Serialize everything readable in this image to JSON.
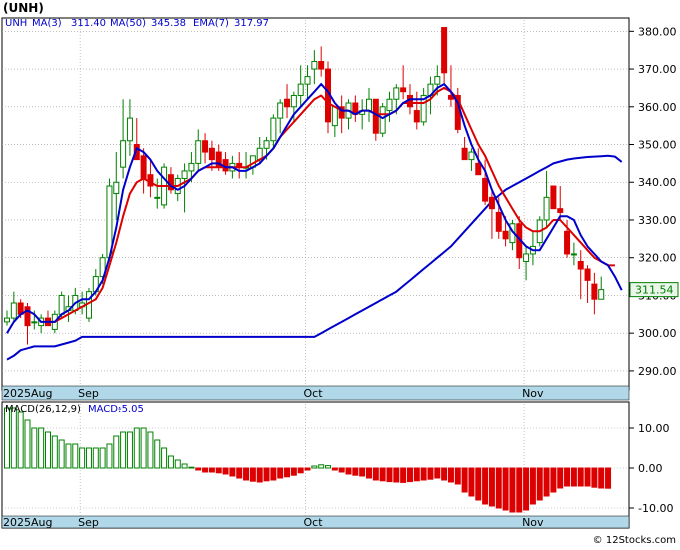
{
  "title": "(UNH)",
  "indicators": {
    "symbol": "UNH",
    "ma3": {
      "label": "MA(3)",
      "value": "311.40",
      "color": "#0000cc"
    },
    "ma50": {
      "label": "MA(50)",
      "value": "345.38",
      "color": "#0000cc"
    },
    "ema7": {
      "label": "EMA(7)",
      "value": "317.97",
      "color": "#dd0000"
    }
  },
  "last_price": "311.54",
  "macd": {
    "label": "MACD(26,12,9)",
    "value_label": "MACD:",
    "value": "-5.05"
  },
  "x_axis_labels": {
    "year_month": "2025Aug",
    "months": [
      "Sep",
      "Oct",
      "Nov"
    ]
  },
  "watermark": "© 12Stocks.com",
  "colors": {
    "up": "#008000",
    "down": "#dd0000",
    "ma": "#0000cc",
    "ema": "#dd0000",
    "axis_band": "#b0d8e8",
    "grid": "#999999"
  },
  "chart_data": [
    {
      "type": "candlestick",
      "ylim": [
        286,
        383
      ],
      "yticks": [
        "290.00",
        "300.00",
        "310.00",
        "320.00",
        "330.00",
        "340.00",
        "350.00",
        "360.00",
        "370.00",
        "380.00"
      ],
      "month_starts": [
        {
          "label": "Sep",
          "index": 11
        },
        {
          "label": "Oct",
          "index": 44
        },
        {
          "label": "Nov",
          "index": 76
        }
      ],
      "ohlc": [
        [
          303,
          306,
          302,
          304
        ],
        [
          304,
          311,
          303,
          308
        ],
        [
          308,
          309,
          304,
          305
        ],
        [
          307,
          308,
          297,
          302
        ],
        [
          303,
          306,
          301,
          303
        ],
        [
          302,
          305,
          300,
          304
        ],
        [
          304,
          306,
          302,
          302
        ],
        [
          301,
          306,
          300,
          305
        ],
        [
          305,
          311,
          304,
          310
        ],
        [
          306,
          310,
          303,
          307
        ],
        [
          306,
          312,
          305,
          310
        ],
        [
          307,
          311,
          305,
          308
        ],
        [
          304,
          312,
          303,
          311
        ],
        [
          311,
          317,
          310,
          315
        ],
        [
          315,
          321,
          313,
          320
        ],
        [
          320,
          341,
          319,
          339
        ],
        [
          337,
          348,
          330,
          340
        ],
        [
          344,
          362,
          341,
          351
        ],
        [
          351,
          362,
          347,
          357
        ],
        [
          350,
          357,
          346,
          346
        ],
        [
          347,
          349,
          337,
          341
        ],
        [
          342,
          346,
          336,
          339
        ],
        [
          336,
          341,
          333,
          336
        ],
        [
          334,
          345,
          333,
          344
        ],
        [
          342,
          344,
          337,
          338
        ],
        [
          337,
          342,
          335,
          341
        ],
        [
          341,
          345,
          332,
          343
        ],
        [
          343,
          348,
          340,
          345
        ],
        [
          345,
          354,
          343,
          351
        ],
        [
          351,
          353,
          345,
          348
        ],
        [
          349,
          351,
          343,
          346
        ],
        [
          348,
          350,
          343,
          344
        ],
        [
          346,
          348,
          342,
          343
        ],
        [
          343,
          347,
          341,
          345
        ],
        [
          345,
          348,
          341,
          344
        ],
        [
          344,
          348,
          341,
          344
        ],
        [
          344,
          347,
          342,
          347
        ],
        [
          346,
          352,
          345,
          349
        ],
        [
          349,
          352,
          346,
          351
        ],
        [
          351,
          358,
          349,
          357
        ],
        [
          357,
          362,
          353,
          361
        ],
        [
          362,
          366,
          357,
          360
        ],
        [
          360,
          364,
          356,
          363
        ],
        [
          363,
          371,
          360,
          366
        ],
        [
          366,
          371,
          362,
          368
        ],
        [
          370,
          375,
          366,
          372
        ],
        [
          372,
          376,
          368,
          370
        ],
        [
          370,
          372,
          353,
          356
        ],
        [
          355,
          360,
          352,
          360
        ],
        [
          360,
          363,
          353,
          357
        ],
        [
          357,
          362,
          354,
          361
        ],
        [
          361,
          363,
          356,
          358
        ],
        [
          358,
          362,
          354,
          359
        ],
        [
          359,
          365,
          356,
          362
        ],
        [
          362,
          362,
          351,
          353
        ],
        [
          353,
          361,
          352,
          360
        ],
        [
          359,
          364,
          356,
          362
        ],
        [
          362,
          366,
          358,
          365
        ],
        [
          365,
          371,
          362,
          364
        ],
        [
          363,
          366,
          358,
          360
        ],
        [
          359,
          364,
          354,
          356
        ],
        [
          356,
          365,
          355,
          363
        ],
        [
          363,
          368,
          358,
          366
        ],
        [
          366,
          371,
          363,
          368
        ],
        [
          381,
          381,
          366,
          369
        ],
        [
          363,
          371,
          360,
          362
        ],
        [
          363,
          365,
          353,
          354
        ],
        [
          349,
          352,
          346,
          346
        ],
        [
          346,
          349,
          343,
          348
        ],
        [
          345,
          349,
          342,
          342
        ],
        [
          341,
          346,
          334,
          335
        ],
        [
          336,
          338,
          325,
          333
        ],
        [
          332,
          336,
          325,
          327
        ],
        [
          327,
          331,
          323,
          325
        ],
        [
          324,
          330,
          322,
          329
        ],
        [
          329,
          331,
          317,
          320
        ],
        [
          319,
          323,
          314,
          321
        ],
        [
          321,
          327,
          318,
          323
        ],
        [
          324,
          331,
          323,
          330
        ],
        [
          330,
          343,
          328,
          336
        ],
        [
          339,
          339,
          333,
          333
        ],
        [
          333,
          339,
          330,
          332
        ],
        [
          327,
          330,
          320,
          321
        ],
        [
          321,
          324,
          318,
          321
        ],
        [
          319,
          322,
          309,
          317
        ],
        [
          317,
          318,
          308,
          314
        ],
        [
          313,
          316,
          305,
          309
        ],
        [
          309,
          315,
          309,
          311.54
        ]
      ],
      "ma3": [
        300,
        303,
        305,
        306,
        305,
        303,
        303,
        303,
        305,
        306,
        308,
        309,
        309,
        311,
        314,
        320,
        328,
        338,
        344,
        349,
        348,
        346,
        343,
        341,
        339,
        338,
        339,
        341,
        343,
        344,
        345,
        345,
        344,
        344,
        343,
        343,
        344,
        345,
        347,
        349,
        352,
        355,
        358,
        360,
        362,
        364,
        366,
        364,
        361,
        359,
        359,
        358,
        359,
        359,
        358,
        357,
        358,
        359,
        361,
        362,
        362,
        362,
        363,
        365,
        366,
        364,
        361,
        355,
        350,
        346,
        343,
        338,
        334,
        330,
        327,
        325,
        323,
        322,
        322,
        325,
        328,
        331,
        331,
        330,
        326,
        323,
        321,
        319,
        318,
        315,
        311.4
      ],
      "ema7": [
        null,
        null,
        null,
        null,
        null,
        null,
        303,
        303,
        304,
        305,
        306,
        307,
        308,
        309,
        312,
        318,
        324,
        331,
        337,
        340,
        341,
        340,
        339,
        339,
        339,
        339,
        340,
        341,
        343,
        344,
        344,
        344,
        344,
        344,
        344,
        344,
        345,
        346,
        347,
        349,
        352,
        354,
        356,
        358,
        360,
        362,
        363,
        361,
        360,
        359,
        359,
        358,
        359,
        359,
        358,
        358,
        358,
        359,
        361,
        361,
        361,
        361,
        362,
        364,
        365,
        364,
        362,
        358,
        354,
        350,
        347,
        343,
        339,
        336,
        333,
        330,
        328,
        327,
        327,
        328,
        330,
        330,
        328,
        326,
        324,
        322,
        320,
        319,
        318,
        317.97
      ],
      "ma50": [
        293,
        294,
        295.5,
        296,
        296.5,
        296.5,
        296.5,
        296.5,
        297,
        297.5,
        298,
        299,
        299,
        299,
        299,
        299,
        299,
        299,
        299,
        299,
        299,
        299,
        299,
        299,
        299,
        299,
        299,
        299,
        299,
        299,
        299,
        299,
        299,
        299,
        299,
        299,
        299,
        299,
        299,
        299,
        299,
        299,
        299,
        299,
        299,
        299,
        300,
        301,
        302,
        303,
        304,
        305,
        306,
        307,
        308,
        309,
        310,
        311,
        312.5,
        314,
        315.5,
        317,
        318.5,
        320,
        321.5,
        323,
        325,
        327,
        329,
        331,
        333,
        335,
        336.5,
        338,
        339,
        340,
        341,
        342,
        343,
        344,
        345,
        345.5,
        346,
        346.3,
        346.5,
        346.7,
        346.8,
        346.9,
        347,
        346.8,
        345.38
      ]
    },
    {
      "type": "bar",
      "name": "MACD",
      "ylim": [
        -12,
        16
      ],
      "yticks": [
        "10.00",
        "0.00",
        "-10.00"
      ],
      "values": [
        15,
        15,
        14,
        12,
        10,
        10,
        9,
        8,
        7,
        6,
        6,
        5,
        5,
        5,
        5,
        6,
        8,
        9,
        9,
        10,
        10,
        9,
        7,
        5,
        3,
        2,
        1,
        0.2,
        -0.5,
        -1,
        -1,
        -1.2,
        -1.5,
        -2,
        -2.5,
        -3,
        -3.3,
        -3.5,
        -3.2,
        -3,
        -2.5,
        -2.2,
        -1.8,
        -1.2,
        -0.5,
        0.5,
        0.8,
        0.6,
        -0.5,
        -1,
        -1.5,
        -1.8,
        -2,
        -2.5,
        -3,
        -3.2,
        -3.4,
        -3.5,
        -3.6,
        -3.4,
        -3.2,
        -3,
        -2.8,
        -2.5,
        -3,
        -3.5,
        -4,
        -6,
        -7,
        -8,
        -9,
        -9.5,
        -10,
        -10.5,
        -11,
        -11,
        -10.5,
        -9,
        -8,
        -7,
        -6,
        -5,
        -4.5,
        -4.5,
        -4.5,
        -4.5,
        -4.8,
        -5,
        -5.05
      ]
    }
  ]
}
